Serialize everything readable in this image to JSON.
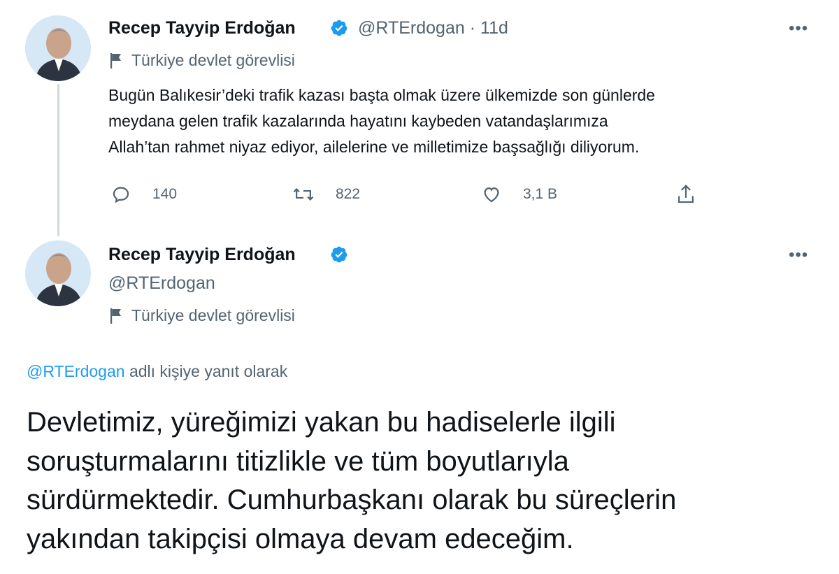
{
  "tweet1": {
    "name": "Recep Tayyip Erdoğan",
    "handle": "@RTErdogan",
    "separator": "·",
    "time": "11d",
    "label": "Türkiye devlet görevlisi",
    "text_lines": [
      "Bugün Balıkesir’deki trafik kazası başta olmak üzere ülkemizde son günlerde",
      "meydana gelen trafik kazalarında hayatını kaybeden vatandaşlarımıza",
      "Allah’tan rahmet niyaz ediyor, ailelerine ve milletimize başsağlığı diliyorum."
    ],
    "actions": {
      "replies": "140",
      "retweets": "822",
      "likes": "3,1 B"
    }
  },
  "tweet2": {
    "name": "Recep Tayyip Erdoğan",
    "handle": "@RTErdogan",
    "label": "Türkiye devlet görevlisi",
    "reply_mention": "@RTErdogan",
    "reply_suffix": " adlı kişiye yanıt olarak",
    "text_lines": [
      "Devletimiz, yüreğimizi yakan bu hadiselerle ilgili",
      "soruşturmalarını titizlikle ve tüm boyutlarıyla",
      "sürdürmektedir. Cumhurbaşkanı olarak bu süreçlerin",
      "yakından takipçisi olmaya devam edeceğim."
    ]
  },
  "more_glyph": "•••",
  "colors": {
    "verified": "#1d9bf0",
    "secondary_text": "#536471",
    "link": "#1d9bf0",
    "thread_line": "#cfd9de"
  }
}
